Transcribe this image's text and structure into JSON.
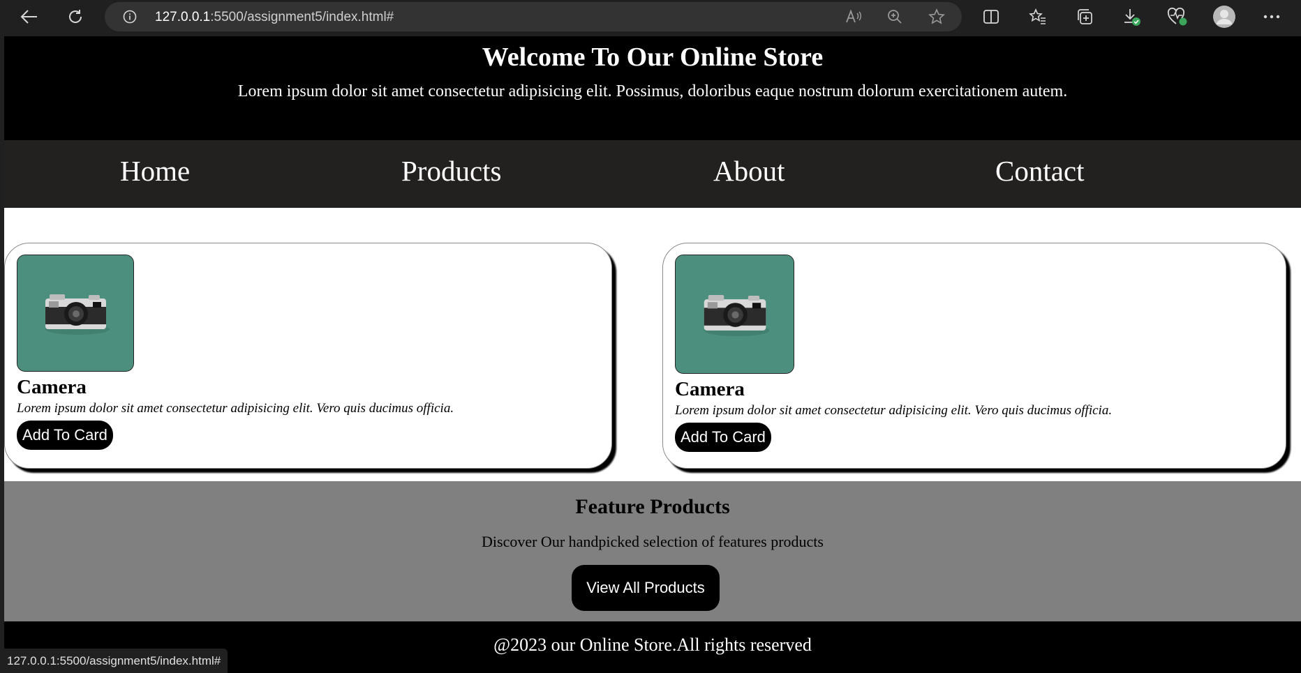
{
  "browser": {
    "url_host": "127.0.0.1",
    "url_rest": ":5500/assignment5/index.html#",
    "status_url": "127.0.0.1:5500/assignment5/index.html#",
    "icons": [
      "back-icon",
      "refresh-icon",
      "info-icon",
      "read-aloud-icon",
      "zoom-icon",
      "favorite-star-icon",
      "split-screen-icon",
      "favorites-icon",
      "collections-icon",
      "downloads-icon",
      "browser-essentials-icon",
      "profile-avatar",
      "more-menu-icon"
    ]
  },
  "header": {
    "title": "Welcome To Our Online Store",
    "tagline": "Lorem ipsum dolor sit amet consectetur adipisicing elit. Possimus, doloribus eaque nostrum dolorum exercitationem autem."
  },
  "nav": {
    "items": [
      {
        "label": "Home"
      },
      {
        "label": "Products"
      },
      {
        "label": "About"
      },
      {
        "label": "Contact"
      }
    ]
  },
  "products": [
    {
      "name": "Camera",
      "description": "Lorem ipsum dolor sit amet consectetur adipisicing elit. Vero quis ducimus officia.",
      "button_label": "Add To Card",
      "image": "camera-photo"
    },
    {
      "name": "Camera",
      "description": "Lorem ipsum dolor sit amet consectetur adipisicing elit. Vero quis ducimus officia.",
      "button_label": "Add To Card",
      "image": "camera-photo"
    }
  ],
  "featured": {
    "title": "Feature Products",
    "subtitle": "Discover Our handpicked selection of features products",
    "button_label": "View All Products"
  },
  "footer": {
    "text": "@2023 our Online Store.All rights reserved"
  },
  "colors": {
    "header_bg": "#000000",
    "nav_bg": "#232120",
    "featured_bg": "#808080",
    "photo_bg": "#4c8f7e"
  }
}
